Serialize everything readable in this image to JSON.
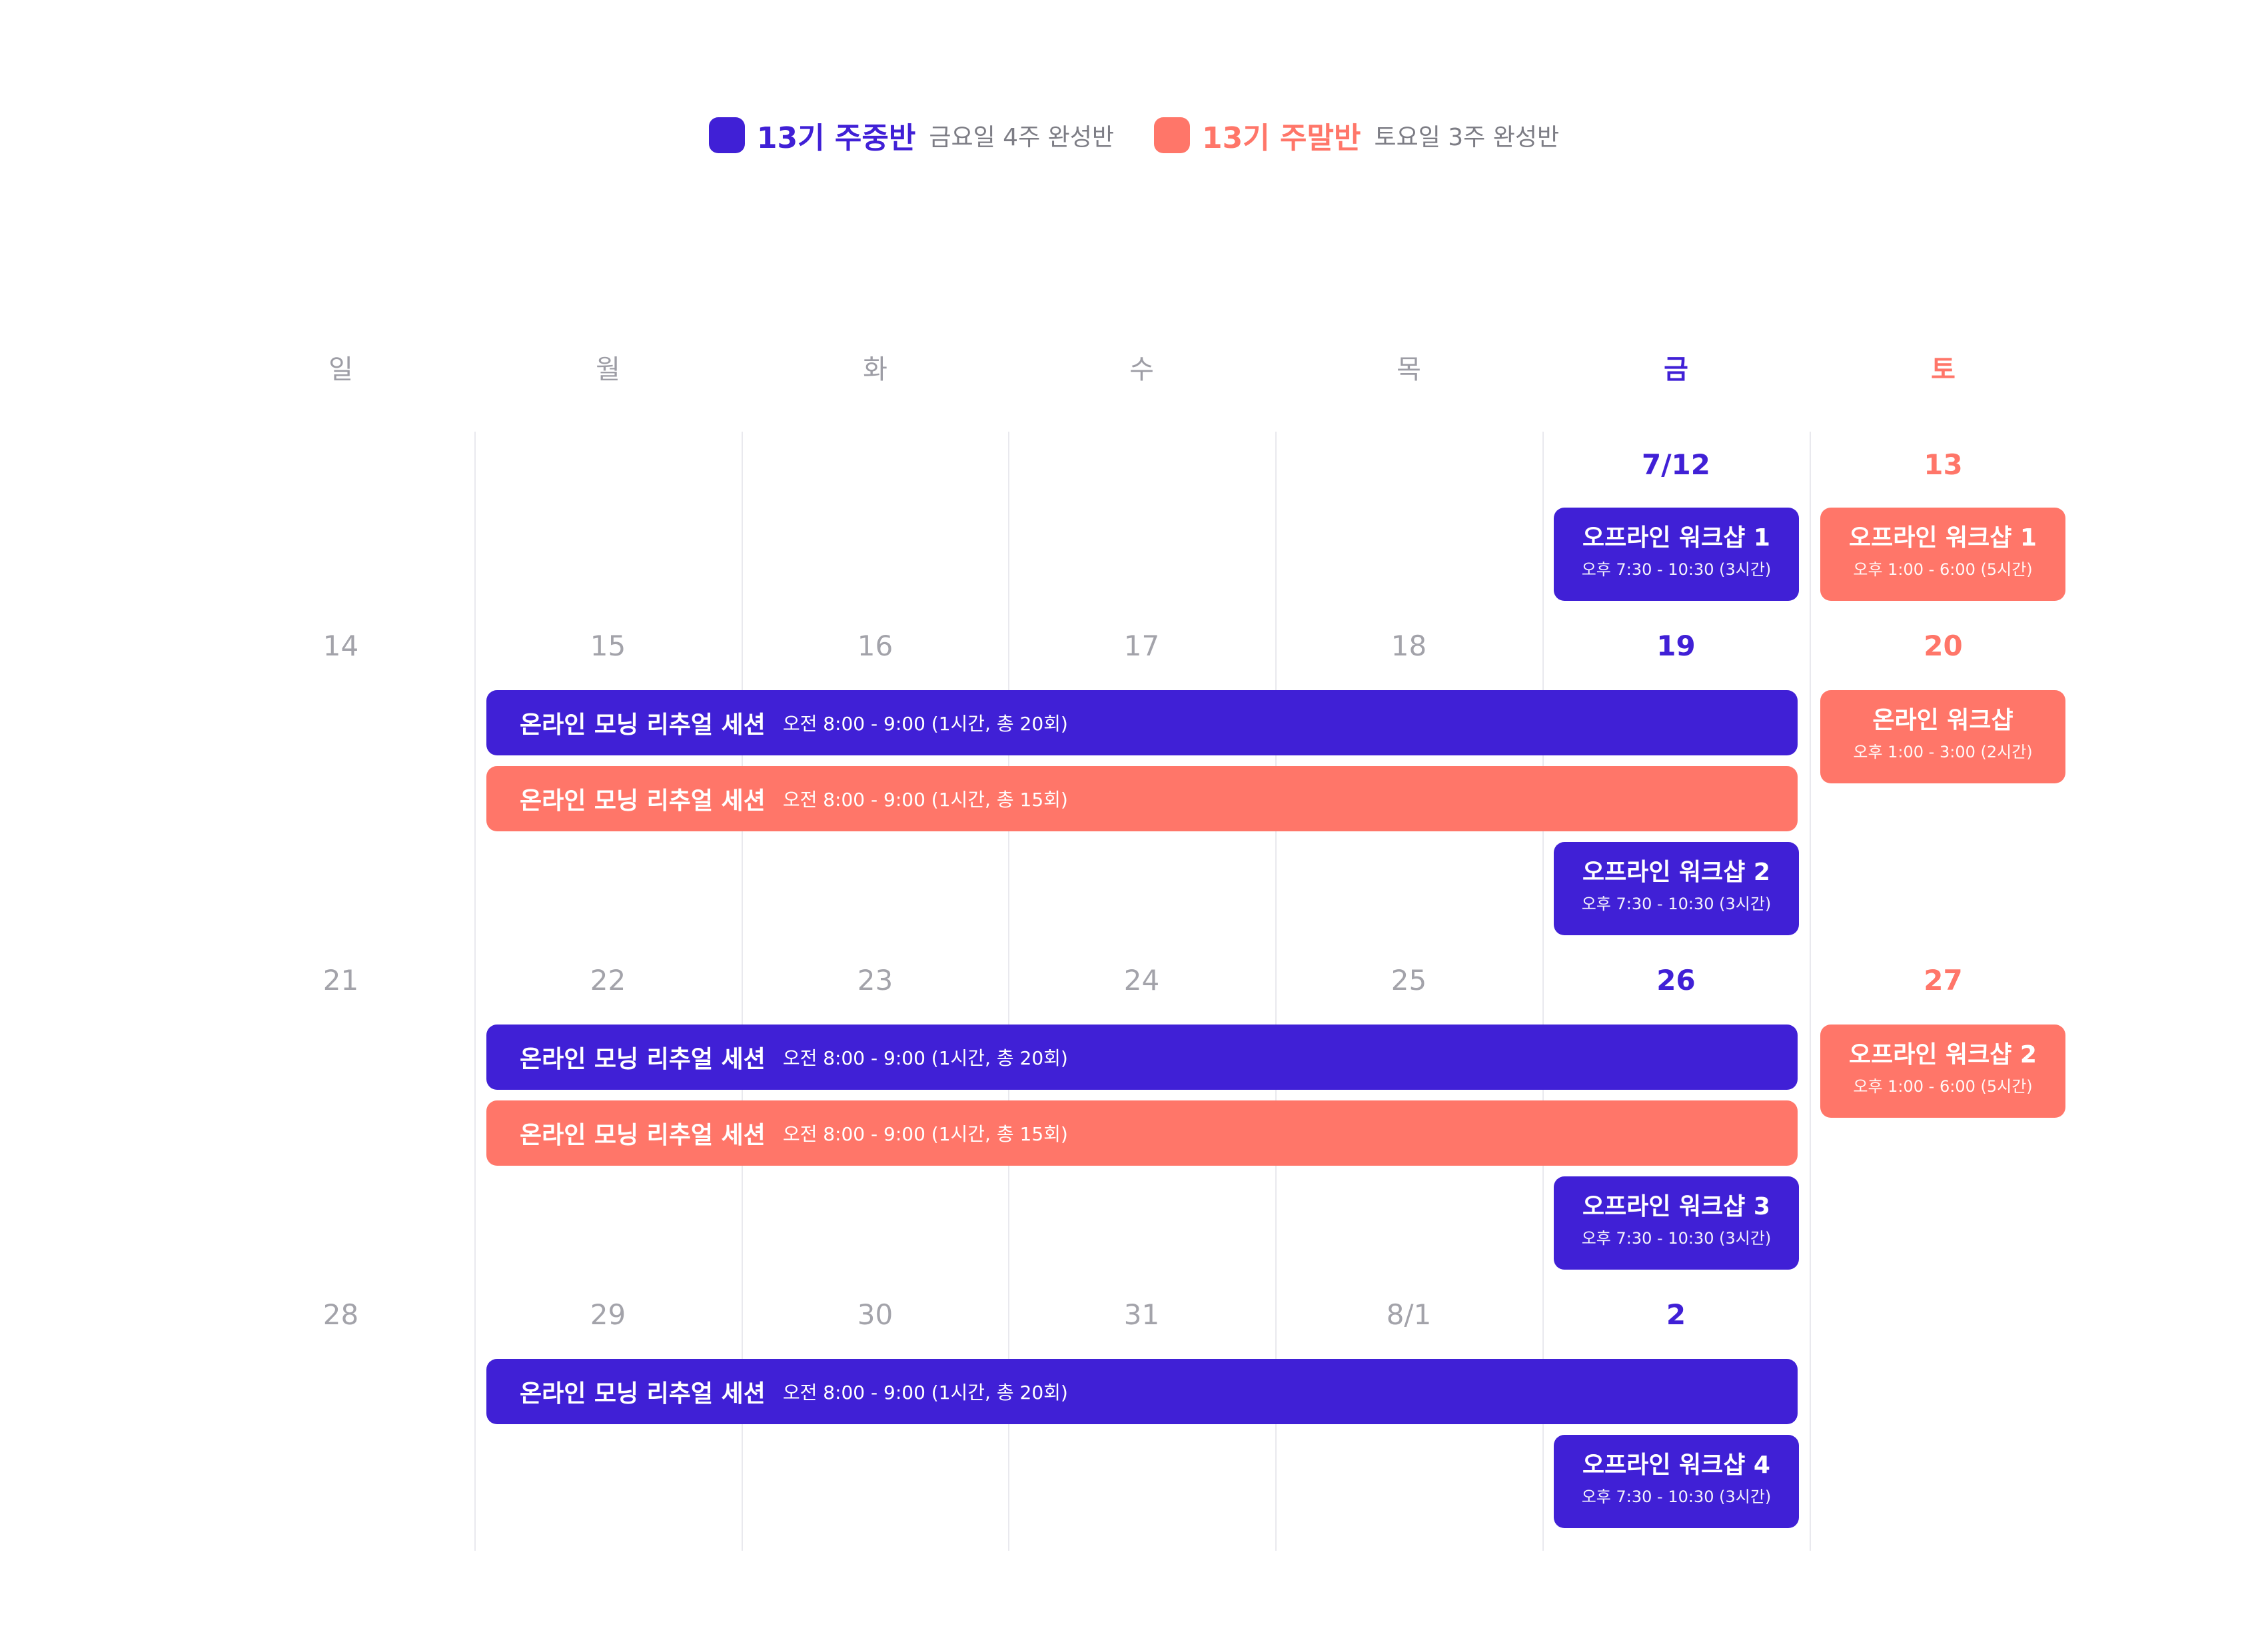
{
  "legend": [
    {
      "title": "13기 주중반",
      "subtitle": "금요일 4주 완성반",
      "color": "#4020d6"
    },
    {
      "title": "13기 주말반",
      "subtitle": "토요일 3주 완성반",
      "color": "#ff7669"
    }
  ],
  "weekdays": [
    "일",
    "월",
    "화",
    "수",
    "목",
    "금",
    "토"
  ],
  "weeks": [
    {
      "dates": [
        "",
        "",
        "",
        "",
        "",
        "7/12",
        "13"
      ]
    },
    {
      "dates": [
        "14",
        "15",
        "16",
        "17",
        "18",
        "19",
        "20"
      ]
    },
    {
      "dates": [
        "21",
        "22",
        "23",
        "24",
        "25",
        "26",
        "27"
      ]
    },
    {
      "dates": [
        "28",
        "29",
        "30",
        "31",
        "8/1",
        "2",
        ""
      ]
    }
  ],
  "events": {
    "fri_w1": {
      "title": "오프라인 워크샵 1",
      "time": "오후 7:30 - 10:30 (3시간)"
    },
    "sat_w1": {
      "title": "오프라인 워크샵 1",
      "time": "오후 1:00 - 6:00 (5시간)"
    },
    "bar_purple_w2": {
      "title": "온라인 모닝 리추얼 세션",
      "time": "오전 8:00 - 9:00 (1시간, 총 20회)"
    },
    "bar_coral_w2": {
      "title": "온라인 모닝 리추얼 세션",
      "time": "오전 8:00 - 9:00 (1시간, 총 15회)"
    },
    "fri_w2": {
      "title": "오프라인 워크샵 2",
      "time": "오후 7:30 - 10:30 (3시간)"
    },
    "sat_w2": {
      "title": "온라인 워크샵",
      "time": "오후 1:00 - 3:00 (2시간)"
    },
    "bar_purple_w3": {
      "title": "온라인 모닝 리추얼 세션",
      "time": "오전 8:00 - 9:00 (1시간, 총 20회)"
    },
    "bar_coral_w3": {
      "title": "온라인 모닝 리추얼 세션",
      "time": "오전 8:00 - 9:00 (1시간, 총 15회)"
    },
    "fri_w3": {
      "title": "오프라인 워크샵 3",
      "time": "오후 7:30 - 10:30 (3시간)"
    },
    "sat_w3": {
      "title": "오프라인 워크샵 2",
      "time": "오후 1:00 - 6:00 (5시간)"
    },
    "bar_purple_w4": {
      "title": "온라인 모닝 리추얼 세션",
      "time": "오전 8:00 - 9:00 (1시간, 총 20회)"
    },
    "fri_w4": {
      "title": "오프라인 워크샵 4",
      "time": "오후 7:30 - 10:30 (3시간)"
    }
  },
  "colors": {
    "weekday_class": "#4020d6",
    "weekend_class": "#ff7669",
    "muted_text": "#a3a3aa",
    "grid": "#e9e9ee"
  }
}
